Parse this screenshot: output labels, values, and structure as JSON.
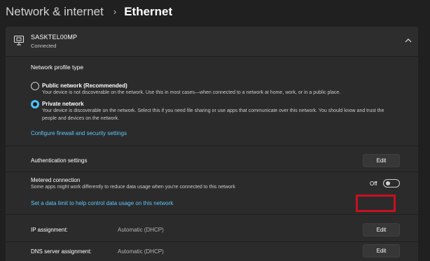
{
  "breadcrumb": {
    "parent": "Network & internet",
    "separator": "›",
    "current": "Ethernet"
  },
  "network": {
    "name": "SASKTEL00MP",
    "status": "Connected",
    "icon": "ethernet-icon"
  },
  "profile": {
    "title": "Network profile type",
    "options": [
      {
        "label": "Public network (Recommended)",
        "description": "Your device is not discoverable on the network. Use this in most cases—when connected to a network at home, work, or in a public place.",
        "selected": false
      },
      {
        "label": "Private network",
        "description_line1": "Your device is discoverable on the network. Select this if you need file sharing or use apps that communicate over this network. You should know and trust the",
        "description_line2": "people and devices on the network.",
        "selected": true
      }
    ],
    "firewall_link": "Configure firewall and security settings"
  },
  "authentication": {
    "label": "Authentication settings",
    "button": "Edit"
  },
  "metered": {
    "label": "Metered connection",
    "description": "Some apps might work differently to reduce data usage when you're connected to this network",
    "toggle_label": "Off",
    "toggle_on": false,
    "data_limit_link": "Set a data limit to help control data usage on this network"
  },
  "ip_assignment": {
    "label": "IP assignment:",
    "value": "Automatic (DHCP)",
    "button": "Edit"
  },
  "dns_assignment": {
    "label": "DNS server assignment:",
    "value": "Automatic (DHCP)",
    "button": "Edit"
  },
  "colors": {
    "background": "#202020",
    "panel": "#2b2b2b",
    "accent": "#4cc2ff",
    "link": "#5ec8ff",
    "highlight": "#c8101f"
  }
}
